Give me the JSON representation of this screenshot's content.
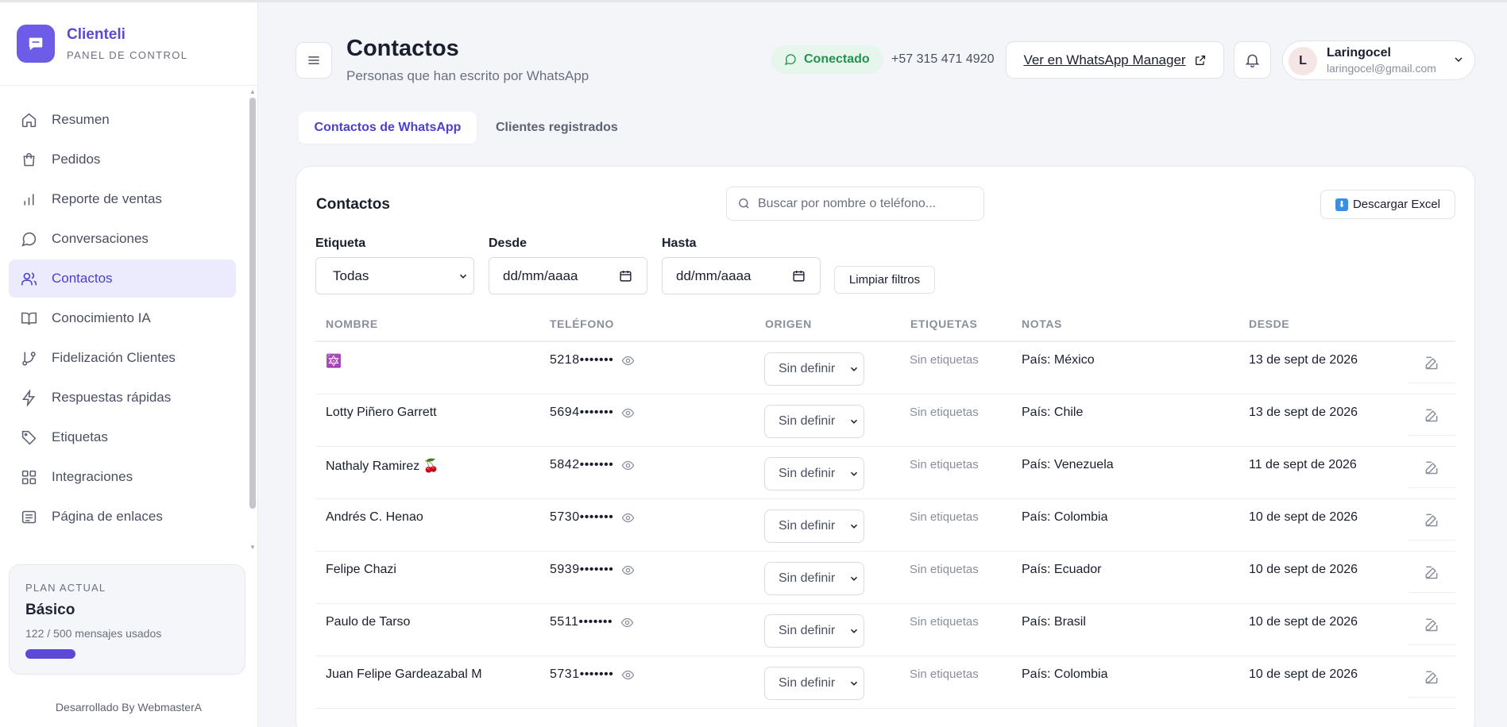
{
  "brand": {
    "name": "Clienteli",
    "subtitle": "PANEL DE CONTROL"
  },
  "sidebar": {
    "items": [
      {
        "label": "Resumen",
        "icon": "home-icon",
        "active": false
      },
      {
        "label": "Pedidos",
        "icon": "shopping-bag-icon",
        "active": false
      },
      {
        "label": "Reporte de ventas",
        "icon": "bar-chart-icon",
        "active": false
      },
      {
        "label": "Conversaciones",
        "icon": "message-circle-icon",
        "active": false
      },
      {
        "label": "Contactos",
        "icon": "users-icon",
        "active": true
      },
      {
        "label": "Conocimiento IA",
        "icon": "book-open-icon",
        "active": false
      },
      {
        "label": "Fidelización Clientes",
        "icon": "git-branch-icon",
        "active": false
      },
      {
        "label": "Respuestas rápidas",
        "icon": "zap-icon",
        "active": false
      },
      {
        "label": "Etiquetas",
        "icon": "tag-icon",
        "active": false
      },
      {
        "label": "Integraciones",
        "icon": "grid-icon",
        "active": false
      },
      {
        "label": "Página de enlaces",
        "icon": "link-page-icon",
        "active": false
      }
    ]
  },
  "plan": {
    "label": "PLAN ACTUAL",
    "name": "Básico",
    "usage": "122 / 500 mensajes usados",
    "used": 122,
    "limit": 500
  },
  "footer": {
    "credit": "Desarrollado By WebmasterA"
  },
  "header": {
    "title": "Contactos",
    "subtitle": "Personas que han escrito por WhatsApp",
    "status": "Conectado",
    "phone": "+57 315 471 4920",
    "whatsapp_button": "Ver en WhatsApp Manager"
  },
  "user": {
    "initial": "L",
    "name": "Laringocel",
    "email": "laringocel@gmail.com"
  },
  "tabs": [
    {
      "label": "Contactos de WhatsApp",
      "active": true
    },
    {
      "label": "Clientes registrados",
      "active": false
    }
  ],
  "card": {
    "title": "Contactos",
    "search_placeholder": "Buscar por nombre o teléfono...",
    "download_label": "Descargar Excel"
  },
  "filters": {
    "tag_label": "Etiqueta",
    "tag_value": "Todas",
    "from_label": "Desde",
    "from_value": "dd/mm/aaaa",
    "to_label": "Hasta",
    "to_value": "dd/mm/aaaa",
    "clear_label": "Limpiar filtros"
  },
  "table": {
    "headers": [
      "NOMBRE",
      "TELÉFONO",
      "ORIGEN",
      "ETIQUETAS",
      "NOTAS",
      "DESDE"
    ],
    "rows": [
      {
        "name": "🔯",
        "phone": "5218•••••••",
        "origin": "Sin definir",
        "tags": "Sin etiquetas",
        "notes": "País: México",
        "since": "13 de sept de 2026"
      },
      {
        "name": "Lotty Piñero Garrett",
        "phone": "5694•••••••",
        "origin": "Sin definir",
        "tags": "Sin etiquetas",
        "notes": "País: Chile",
        "since": "13 de sept de 2026"
      },
      {
        "name": "Nathaly Ramirez 🍒",
        "phone": "5842•••••••",
        "origin": "Sin definir",
        "tags": "Sin etiquetas",
        "notes": "País: Venezuela",
        "since": "11 de sept de 2026"
      },
      {
        "name": "Andrés C. Henao",
        "phone": "5730•••••••",
        "origin": "Sin definir",
        "tags": "Sin etiquetas",
        "notes": "País: Colombia",
        "since": "10 de sept de 2026"
      },
      {
        "name": "Felipe Chazi",
        "phone": "5939•••••••",
        "origin": "Sin definir",
        "tags": "Sin etiquetas",
        "notes": "País: Ecuador",
        "since": "10 de sept de 2026"
      },
      {
        "name": "Paulo de Tarso",
        "phone": "5511•••••••",
        "origin": "Sin definir",
        "tags": "Sin etiquetas",
        "notes": "País: Brasil",
        "since": "10 de sept de 2026"
      },
      {
        "name": "Juan Felipe Gardeazabal M",
        "phone": "5731•••••••",
        "origin": "Sin definir",
        "tags": "Sin etiquetas",
        "notes": "País: Colombia",
        "since": "10 de sept de 2026"
      }
    ]
  },
  "colors": {
    "accent": "#5b49d6",
    "active_bg": "#ebebfd",
    "connected_green": "#24924f",
    "connected_bg": "#e6f6ec"
  }
}
